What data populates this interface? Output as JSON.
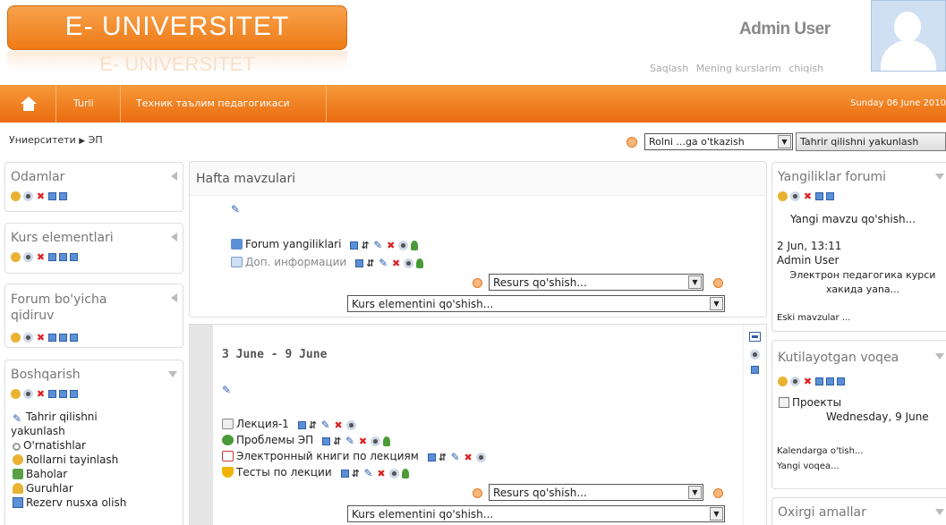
{
  "header": {
    "logo_text": "E- UNIVERSITET",
    "logo_reflection": "E- UNIVERSITET",
    "user_name": "Admin User",
    "user_links": [
      "Saqlash",
      "Mening kurslarim",
      "chiqish"
    ]
  },
  "nav": {
    "home_icon": "home-icon",
    "items": [
      "Turli",
      "Техник таълим педагогикаси"
    ],
    "date": "Sunday 06 June 2010"
  },
  "breadcrumb": {
    "root": "Униерситети",
    "separator": "▶",
    "current": "ЭП"
  },
  "controls": {
    "role_select": "Rolni ...ga o'tkazish",
    "edit_button": "Tahrir qilishni yakunlash"
  },
  "left_blocks": [
    {
      "title": "Odamlar"
    },
    {
      "title": "Kurs elementlari"
    },
    {
      "title": "Forum bo'yicha qidiruv"
    },
    {
      "title": "Boshqarish",
      "items": [
        "Tahrir qilishni",
        "yakunlash",
        "O'rnatishlar",
        "Rollarni tayinlash",
        "Baholar",
        "Guruhlar",
        "Rezerv nusxa olish"
      ]
    }
  ],
  "center": {
    "title": "Hafta mavzulari",
    "section0": {
      "activities": [
        "Forum yangiliklari",
        "Доп. информации"
      ],
      "add_resource": "Resurs qo'shish...",
      "add_element": "Kurs elementini qo'shish..."
    },
    "week1": {
      "title": "3 June - 9 June",
      "activities": [
        "Лекция-1",
        "Проблемы ЭП",
        "Электронный книги по лекциям",
        "Тесты по лекции"
      ],
      "add_resource": "Resurs qo'shish...",
      "add_element": "Kurs elementini qo'shish..."
    }
  },
  "right_blocks": {
    "news": {
      "title": "Yangiliklar forumi",
      "add_topic": "Yangi mavzu qo'shish...",
      "post_date": "2 Jun, 13:11",
      "post_author": "Admin User",
      "post_title": "Электрон педагогика курси хакида yana...",
      "older": "Eski mavzular ..."
    },
    "events": {
      "title": "Kutilayotgan voqea",
      "event_name": "Проекты",
      "event_date": "Wednesday, 9 June",
      "calendar_link": "Kalendarga o'tish...",
      "new_event": "Yangi voqea..."
    },
    "recent": {
      "title": "Oxirgi amallar"
    }
  }
}
